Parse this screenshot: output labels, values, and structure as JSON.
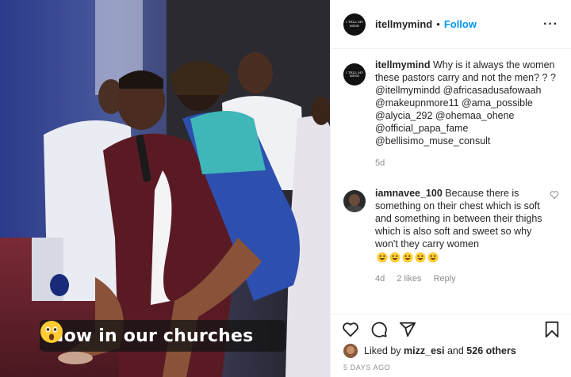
{
  "photo": {
    "caption_text": "Now in our churches",
    "caption_emoji": "astonished-face"
  },
  "post": {
    "username": "itellmymind",
    "separator": "•",
    "follow_label": "Follow",
    "more_label": "···",
    "avatar_logo_text": "I TELL MY MIND"
  },
  "caption": {
    "username": "itellmymind",
    "text": "Why is it always the women these pastors carry and not the men? ? ? @itellmymindd @africasadusafowaah @makeupnmore11 @ama_possible @alycia_292 @ohemaa_ohene @official_papa_fame @bellisimo_muse_consult",
    "time": "5d"
  },
  "reply": {
    "username": "iamnavee_100",
    "text": "Because there is something on their chest which is soft and something in between their thighs which is also soft and sweet so why won't they carry women",
    "emojis": [
      "grinning-face",
      "grinning-face",
      "grinning-face",
      "grinning-face",
      "grinning-face"
    ],
    "time": "4d",
    "likes": "2 likes",
    "reply_label": "Reply"
  },
  "actions": {
    "like_icon": "heart-icon",
    "comment_icon": "comment-icon",
    "share_icon": "share-icon",
    "save_icon": "bookmark-icon"
  },
  "likes": {
    "prefix": "Liked by",
    "user": "mizz_esi",
    "and": "and",
    "others": "526 others"
  },
  "date": "5 DAYS AGO",
  "colors": {
    "link_blue": "#0095f6",
    "text": "#262626",
    "muted": "#8e8e8e",
    "border": "#efefef"
  }
}
